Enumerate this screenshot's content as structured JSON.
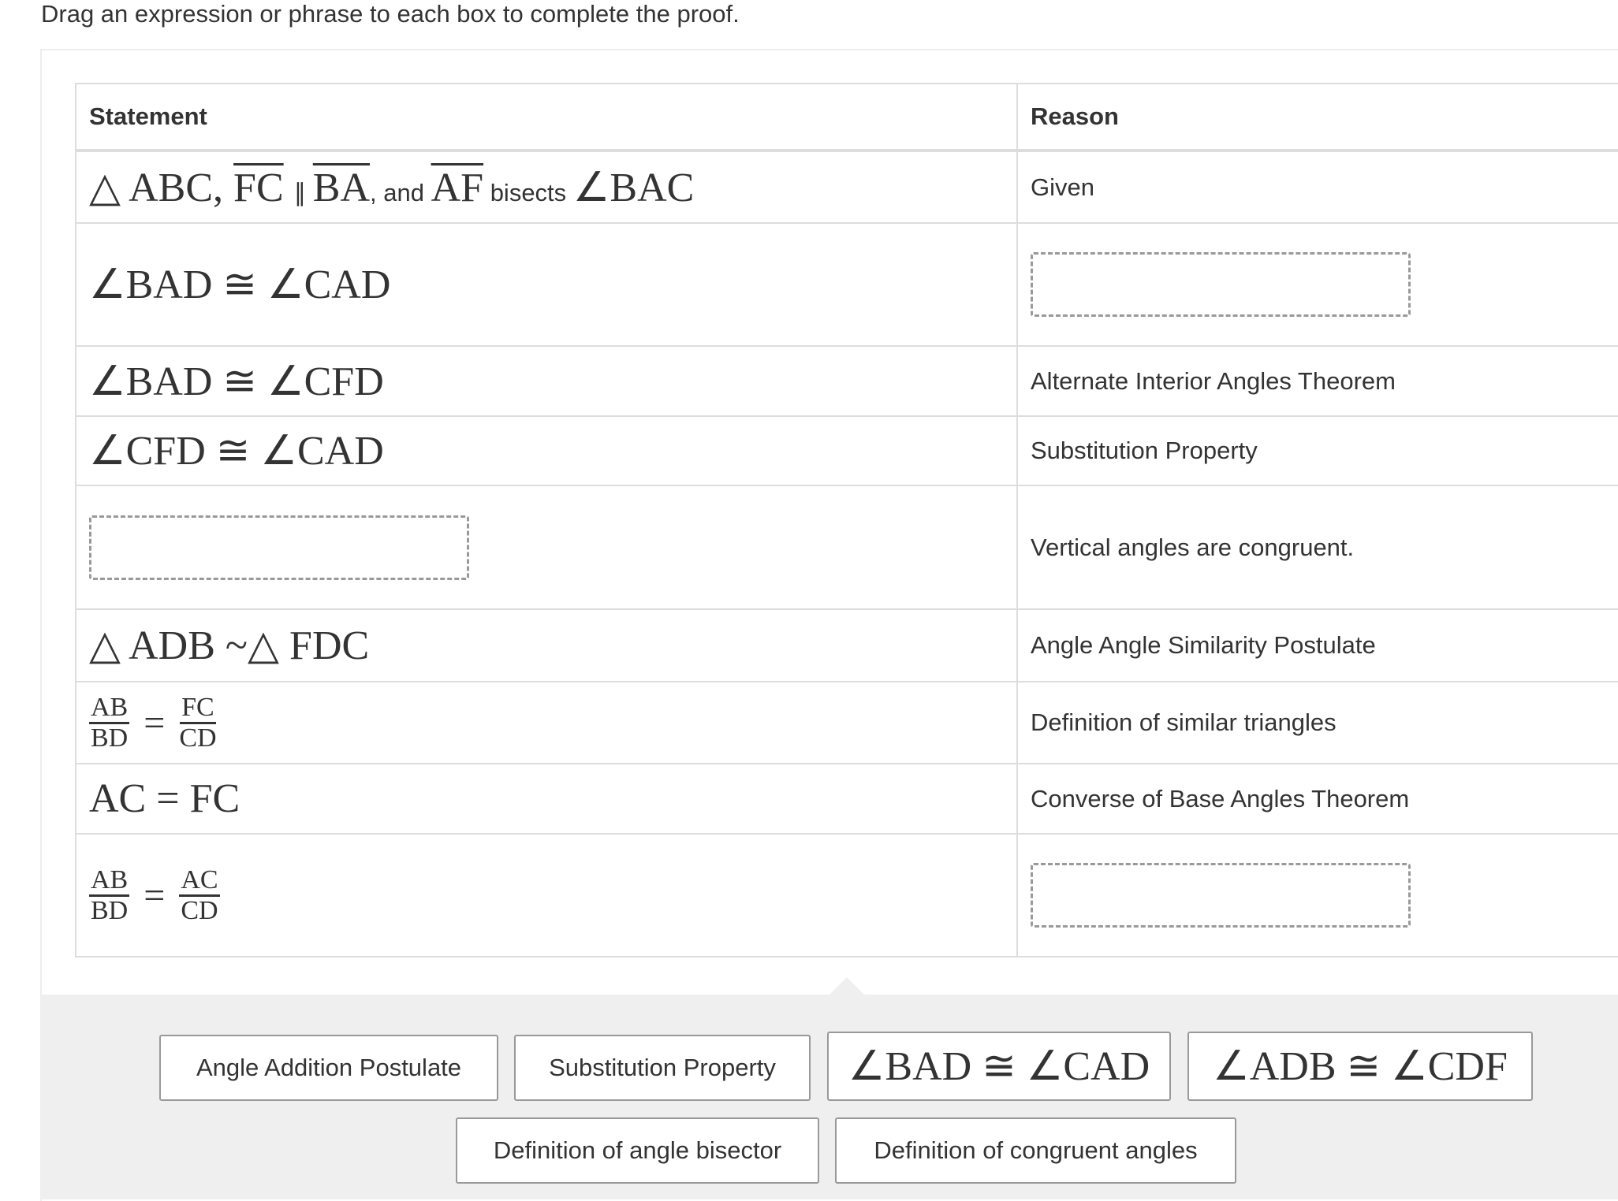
{
  "instruction": "Drag an expression or phrase to each box to complete the proof.",
  "table": {
    "headers": {
      "statement": "Statement",
      "reason": "Reason"
    },
    "rows": [
      {
        "statement": {
          "triangle": "△ ABC,",
          "seg1": "FC",
          "parallel": " ∥ ",
          "seg2": "BA",
          "and": ", and ",
          "seg3": "AF",
          "bisects": " bisects ",
          "angle": "∠BAC"
        },
        "reason": "Given"
      },
      {
        "statement": "∠BAD ≅ ∠CAD",
        "reason": null,
        "reason_dropbox": true
      },
      {
        "statement": "∠BAD ≅ ∠CFD",
        "reason": "Alternate Interior Angles Theorem"
      },
      {
        "statement": "∠CFD ≅ ∠CAD",
        "reason": "Substitution Property"
      },
      {
        "statement": null,
        "statement_dropbox": true,
        "reason": "Vertical angles are congruent."
      },
      {
        "statement": "△ ADB ~△ FDC",
        "reason": "Angle Angle Similarity Postulate"
      },
      {
        "statement": {
          "left_num": "AB",
          "left_den": "BD",
          "eq": "=",
          "right_num": "FC",
          "right_den": "CD"
        },
        "reason": "Definition of similar triangles"
      },
      {
        "statement": "AC = FC",
        "reason": "Converse of Base Angles Theorem"
      },
      {
        "statement": {
          "left_num": "AB",
          "left_den": "BD",
          "eq": "=",
          "right_num": "AC",
          "right_den": "CD"
        },
        "reason": null,
        "reason_dropbox": true
      }
    ]
  },
  "choices": [
    {
      "label": "Angle Addition Postulate",
      "kind": "text"
    },
    {
      "label": "Substitution Property",
      "kind": "text"
    },
    {
      "label": "∠BAD ≅ ∠CAD",
      "kind": "math"
    },
    {
      "label": "∠ADB ≅ ∠CDF",
      "kind": "math"
    },
    {
      "label": "Definition of angle bisector",
      "kind": "text"
    },
    {
      "label": "Definition of congruent angles",
      "kind": "text"
    }
  ],
  "colors": {
    "text": "#333333",
    "border": "#dddddd",
    "dropbox_border": "#999999",
    "tray_bg": "#efefef"
  }
}
